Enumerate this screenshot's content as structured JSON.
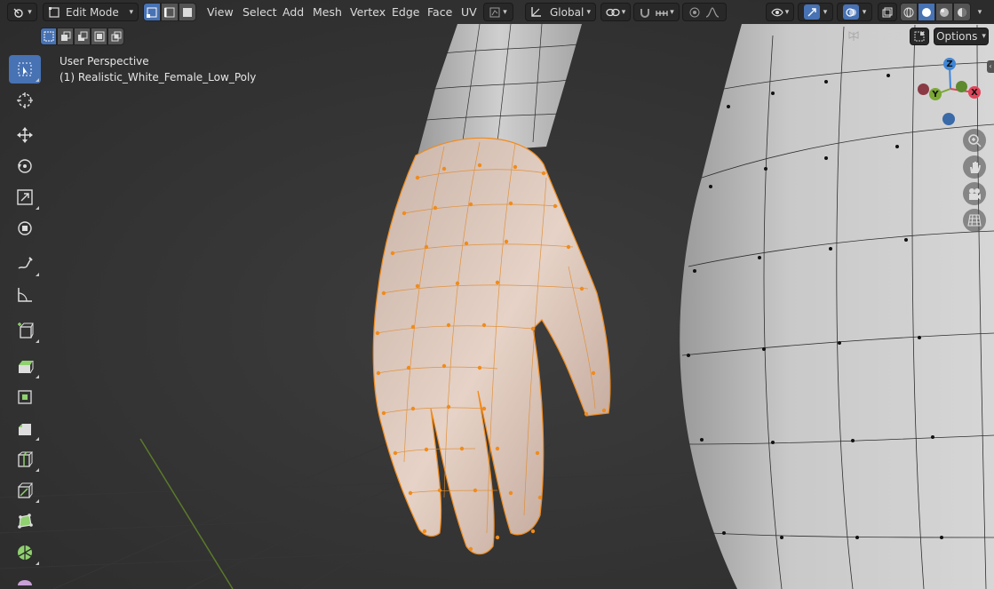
{
  "header": {
    "mode_label": "Edit Mode",
    "menus": [
      "View",
      "Select",
      "Add",
      "Mesh",
      "Vertex",
      "Edge",
      "Face",
      "UV"
    ],
    "transform_orientation": "Global"
  },
  "axis_toggles": [
    "X",
    "Y",
    "Z"
  ],
  "options_label": "Options",
  "viewport": {
    "view_name": "User Perspective",
    "object_name": "(1) Realistic_White_Female_Low_Poly"
  },
  "gizmo": {
    "z": "Z",
    "y": "Y",
    "x": "X"
  },
  "colors": {
    "accent": "#4772b3",
    "selected_mesh": "#f08b1c",
    "axis_x": "#e0455a",
    "axis_y": "#7aa832",
    "axis_z": "#3f86d6",
    "background": "#2b2b2b"
  },
  "icons": {
    "tools": [
      "select-box-icon",
      "cursor-icon",
      "move-icon",
      "rotate-icon",
      "scale-icon",
      "transform-icon",
      "annotate-icon",
      "measure-icon",
      "add-cube-icon",
      "extrude-icon",
      "inset-icon",
      "bevel-icon",
      "loop-cut-icon",
      "knife-icon",
      "poly-build-icon",
      "spin-icon",
      "smooth-icon"
    ],
    "nav": [
      "zoom-icon",
      "hand-pan-icon",
      "camera-icon",
      "grid-ortho-icon"
    ]
  }
}
